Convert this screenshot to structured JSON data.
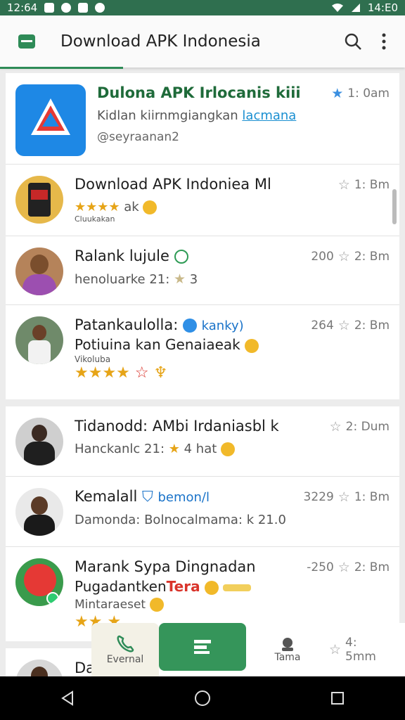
{
  "status_bar": {
    "time_left": "12:64",
    "time_right": "14:E0"
  },
  "app_bar": {
    "title": "Download APK Indonesia",
    "icons": [
      "app-logo-icon",
      "search-icon",
      "more-vert-icon"
    ]
  },
  "items": [
    {
      "name": "Dulona APK Irlocanis kiii",
      "line2_text": "Kidlan kiirnmgiangkan ",
      "line2_link": "lacmana",
      "line3": "@seyraanan2",
      "time": "1: 0am",
      "star_style": "blue"
    },
    {
      "name": "Download APK Indoniea Ml",
      "line2": "ak",
      "line3": "Cluukakan",
      "time": "1: Bm"
    },
    {
      "name": "Ralank lujule",
      "line2": "henoluarke 21: ",
      "line2_tail": "3",
      "count": "200",
      "time": "2: Bm"
    },
    {
      "name": "Patankaulolla:",
      "name_tail": "kanky)",
      "line2": "Potiuina kan Genaiaeak",
      "line3": "Vikoluba",
      "count": "264",
      "time": "2: Bm"
    },
    {
      "name": "Tidanodd: AMbi Irdaniasbl k",
      "line2": "Hanckanlc 21: ",
      "line2_tail": "4  hat",
      "time": "2: Dum"
    },
    {
      "name": "Kemalall",
      "name_tail": "bemon/l",
      "line2": "Damonda: Bolnocalmama: k 21.0",
      "count": "3229",
      "time": "1: Bm"
    },
    {
      "name": "Marank Sypa Dingnadan",
      "line2": "Pugadantken",
      "line2_tag": "Tera",
      "line3": "Mintaraeset",
      "count": "-250",
      "time": "2: Bm"
    },
    {
      "name": "Da",
      "time": "4: 5mm"
    }
  ],
  "bottom_bar": {
    "call_label": "Evernal",
    "team_label": "Tama"
  }
}
